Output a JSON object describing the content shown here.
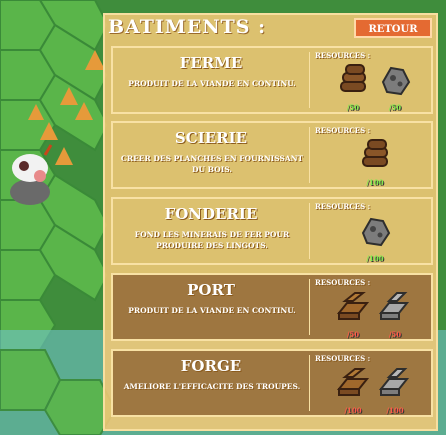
{
  "panel": {
    "title": "BATIMENTS :",
    "back_label": "RETOUR"
  },
  "buildings": [
    {
      "name": "FERME",
      "desc": "PRODUIT DE LA VIANDE EN CONTINU.",
      "res_label": "RESOURCES :",
      "state": "on",
      "resources": [
        {
          "icon": "wood-logs-icon",
          "count": "/50",
          "status": "ok"
        },
        {
          "icon": "stone-ore-icon",
          "count": "/50",
          "status": "ok"
        }
      ]
    },
    {
      "name": "SCIERIE",
      "desc": "CREER DES PLANCHES EN FOURNISSANT DU BOIS.",
      "res_label": "RESOURCES :",
      "state": "on",
      "resources": [
        {
          "icon": "wood-logs-icon",
          "count": "/100",
          "status": "ok"
        }
      ]
    },
    {
      "name": "FONDERIE",
      "desc": "FOND LES MINERAIS DE FER POUR PRODUIRE DES LINGOTS.",
      "res_label": "RESOURCES :",
      "state": "on",
      "resources": [
        {
          "icon": "stone-ore-icon",
          "count": "/100",
          "status": "ok"
        }
      ]
    },
    {
      "name": "PORT",
      "desc": "PRODUIT DE LA VIANDE EN CONTINU.",
      "res_label": "RESOURCES :",
      "state": "off",
      "resources": [
        {
          "icon": "planks-icon",
          "count": "/50",
          "status": "low"
        },
        {
          "icon": "ingots-icon",
          "count": "/50",
          "status": "low"
        }
      ]
    },
    {
      "name": "FORGE",
      "desc": "AMELIORE L'EFFICACITE DES TROUPES.",
      "res_label": "RESOURCES :",
      "state": "off",
      "resources": [
        {
          "icon": "planks-icon",
          "count": "/100",
          "status": "low"
        },
        {
          "icon": "ingots-icon",
          "count": "/100",
          "status": "low"
        }
      ]
    }
  ],
  "colors": {
    "accent": "#e46a32",
    "ok": "#7dea4b",
    "low": "#ff5a4a",
    "grass": "#5aa844",
    "panel": "#f3c876"
  }
}
